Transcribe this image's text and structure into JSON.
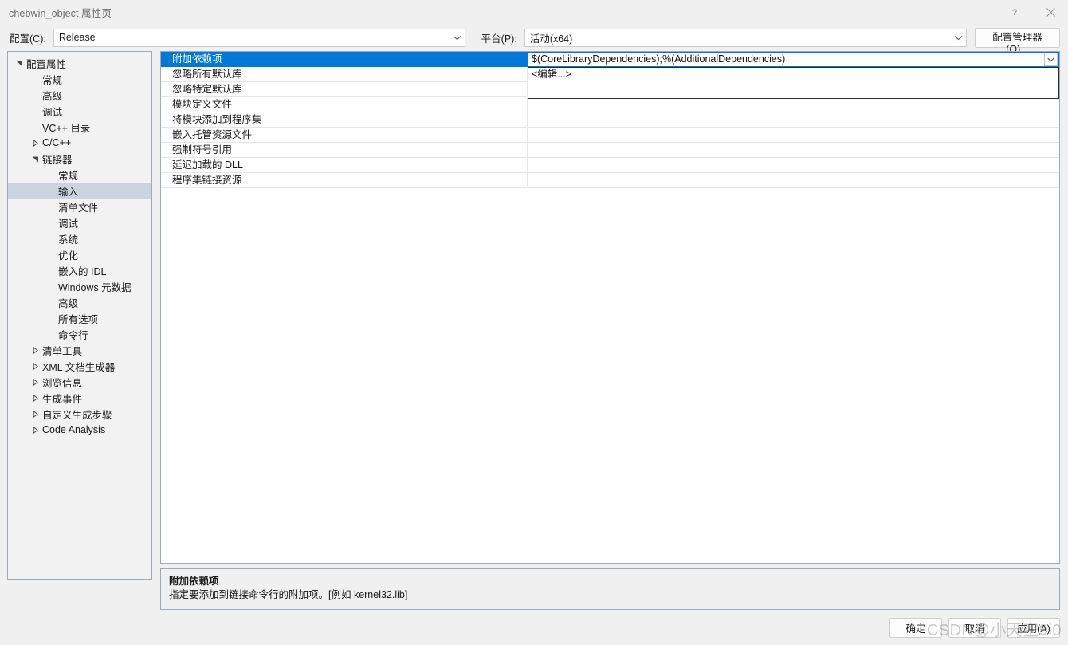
{
  "window": {
    "title": "chebwin_object 属性页",
    "help_button": "?",
    "close_button": "×"
  },
  "configbar": {
    "config_label": "配置(C):",
    "config_value": "Release",
    "platform_label": "平台(P):",
    "platform_value": "活动(x64)",
    "config_manager_label": "配置管理器(O)..."
  },
  "tree": {
    "items": [
      {
        "label": "配置属性",
        "indent": 0,
        "twisty": "expanded",
        "selected": false
      },
      {
        "label": "常规",
        "indent": 1,
        "twisty": "none",
        "selected": false
      },
      {
        "label": "高级",
        "indent": 1,
        "twisty": "none",
        "selected": false
      },
      {
        "label": "调试",
        "indent": 1,
        "twisty": "none",
        "selected": false
      },
      {
        "label": "VC++ 目录",
        "indent": 1,
        "twisty": "none",
        "selected": false
      },
      {
        "label": "C/C++",
        "indent": 1,
        "twisty": "collapsed",
        "selected": false
      },
      {
        "label": "链接器",
        "indent": 1,
        "twisty": "expanded",
        "selected": false
      },
      {
        "label": "常规",
        "indent": 2,
        "twisty": "none",
        "selected": false
      },
      {
        "label": "输入",
        "indent": 2,
        "twisty": "none",
        "selected": true
      },
      {
        "label": "清单文件",
        "indent": 2,
        "twisty": "none",
        "selected": false
      },
      {
        "label": "调试",
        "indent": 2,
        "twisty": "none",
        "selected": false
      },
      {
        "label": "系统",
        "indent": 2,
        "twisty": "none",
        "selected": false
      },
      {
        "label": "优化",
        "indent": 2,
        "twisty": "none",
        "selected": false
      },
      {
        "label": "嵌入的 IDL",
        "indent": 2,
        "twisty": "none",
        "selected": false
      },
      {
        "label": "Windows 元数据",
        "indent": 2,
        "twisty": "none",
        "selected": false
      },
      {
        "label": "高级",
        "indent": 2,
        "twisty": "none",
        "selected": false
      },
      {
        "label": "所有选项",
        "indent": 2,
        "twisty": "none",
        "selected": false
      },
      {
        "label": "命令行",
        "indent": 2,
        "twisty": "none",
        "selected": false
      },
      {
        "label": "清单工具",
        "indent": 1,
        "twisty": "collapsed",
        "selected": false
      },
      {
        "label": "XML 文档生成器",
        "indent": 1,
        "twisty": "collapsed",
        "selected": false
      },
      {
        "label": "浏览信息",
        "indent": 1,
        "twisty": "collapsed",
        "selected": false
      },
      {
        "label": "生成事件",
        "indent": 1,
        "twisty": "collapsed",
        "selected": false
      },
      {
        "label": "自定义生成步骤",
        "indent": 1,
        "twisty": "collapsed",
        "selected": false
      },
      {
        "label": "Code Analysis",
        "indent": 1,
        "twisty": "collapsed",
        "selected": false
      }
    ]
  },
  "grid": {
    "rows": [
      {
        "name": "附加依赖项",
        "value": "$(CoreLibraryDependencies);%(AdditionalDependencies)",
        "selected": true
      },
      {
        "name": "忽略所有默认库",
        "value": "",
        "selected": false
      },
      {
        "name": "忽略特定默认库",
        "value": "",
        "selected": false
      },
      {
        "name": "模块定义文件",
        "value": "",
        "selected": false
      },
      {
        "name": "将模块添加到程序集",
        "value": "",
        "selected": false
      },
      {
        "name": "嵌入托管资源文件",
        "value": "",
        "selected": false
      },
      {
        "name": "强制符号引用",
        "value": "",
        "selected": false
      },
      {
        "name": "延迟加载的 DLL",
        "value": "",
        "selected": false
      },
      {
        "name": "程序集链接资源",
        "value": "",
        "selected": false
      }
    ],
    "editor_value": "$(CoreLibraryDependencies);%(AdditionalDependencies)",
    "dropdown_items": [
      "<编辑...>"
    ]
  },
  "description": {
    "title": "附加依赖项",
    "text": "指定要添加到链接命令行的附加项。[例如 kernel32.lib]"
  },
  "footer": {
    "ok_label": "确定",
    "cancel_label": "取消",
    "apply_label": "应用(A)"
  },
  "watermark": {
    "text": "CSDN@小天空9i0"
  },
  "colors": {
    "accent": "#0078d7",
    "tree_selection": "#cdd2e1",
    "panel_border": "#a0aab4",
    "dialog_bg": "#f0f0f0"
  }
}
